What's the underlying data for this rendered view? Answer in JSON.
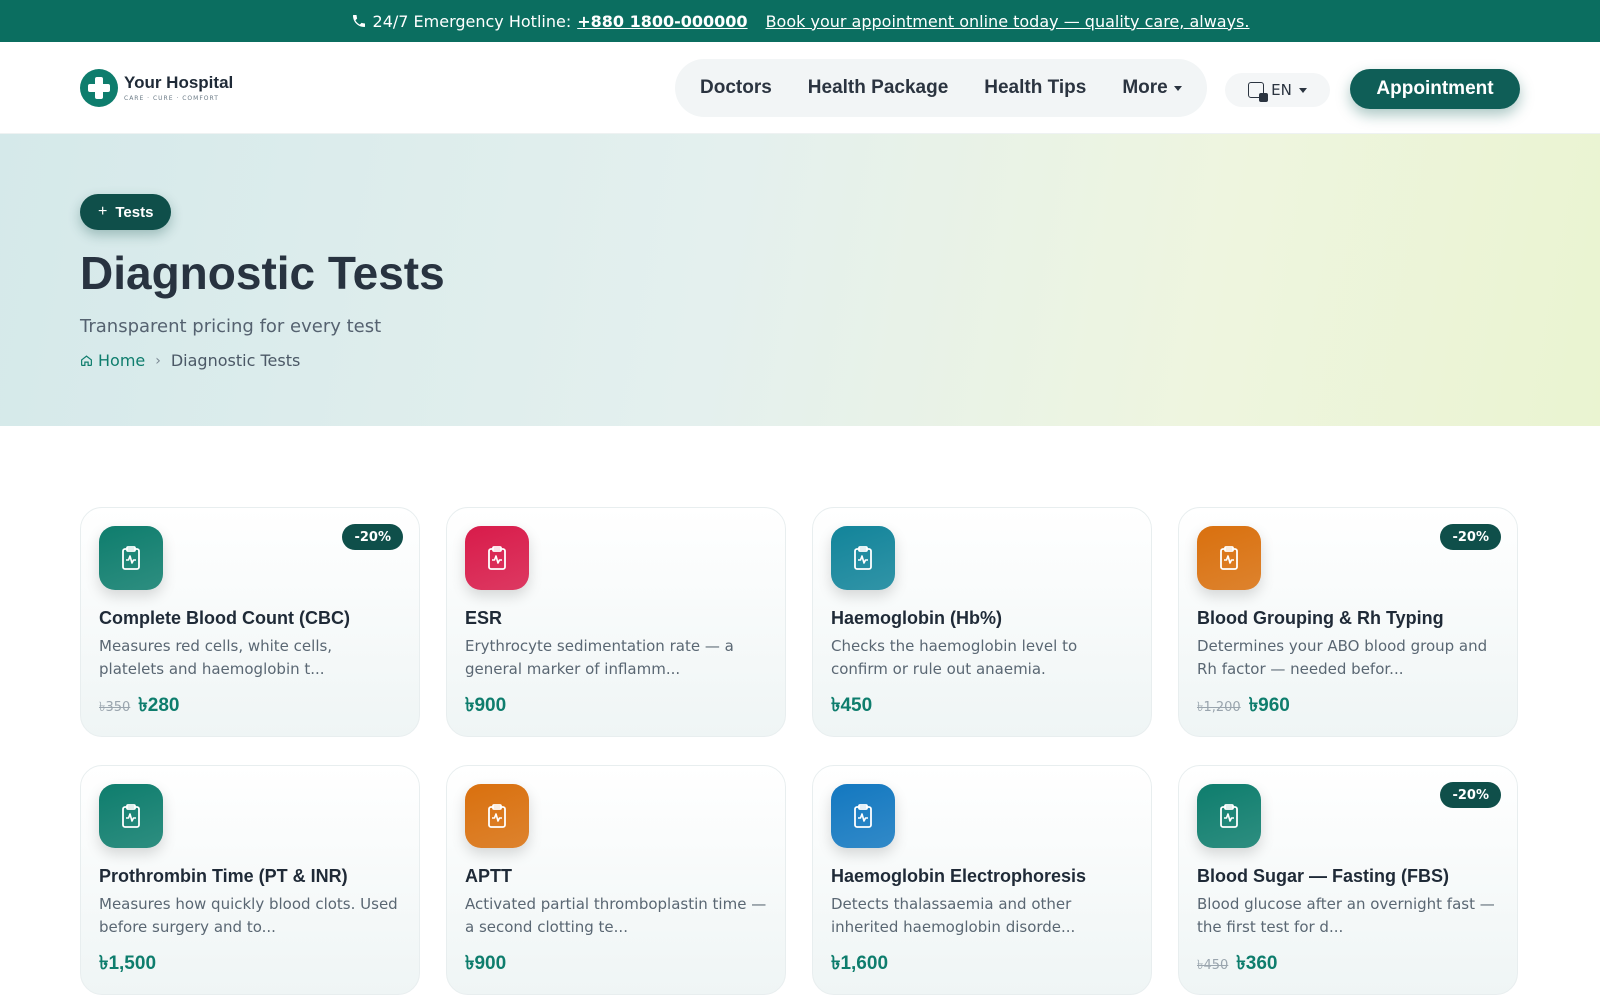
{
  "topbar": {
    "hotline_label": "24/7 Emergency Hotline:",
    "hotline_number": "+880 1800-000000",
    "promo_link": "Book your appointment online today — quality care, always."
  },
  "header": {
    "logo_name": "Your Hospital",
    "logo_tagline": "CARE · CURE · COMFORT",
    "nav": [
      "Doctors",
      "Health Package",
      "Health Tips",
      "More"
    ],
    "language": "EN",
    "appointment_label": "Appointment"
  },
  "hero": {
    "badge": "Tests",
    "title": "Diagnostic Tests",
    "subtitle": "Transparent pricing for every test",
    "breadcrumb_home": "Home",
    "breadcrumb_current": "Diagnostic Tests"
  },
  "tests": [
    {
      "title": "Complete Blood Count (CBC)",
      "desc": "Measures red cells, white cells, platelets and haemoglobin t...",
      "old_price": "৳350",
      "price": "৳280",
      "badge": "-20%",
      "color": "#0e7d6d"
    },
    {
      "title": "ESR",
      "desc": "Erythrocyte sedimentation rate — a general marker of inflamm...",
      "old_price": "",
      "price": "৳900",
      "badge": "",
      "color": "#d81b4a"
    },
    {
      "title": "Haemoglobin (Hb%)",
      "desc": "Checks the haemoglobin level to confirm or rule out anaemia.",
      "old_price": "",
      "price": "৳450",
      "badge": "",
      "color": "#12849a"
    },
    {
      "title": "Blood Grouping & Rh Typing",
      "desc": "Determines your ABO blood group and Rh factor — needed befor...",
      "old_price": "৳1,200",
      "price": "৳960",
      "badge": "-20%",
      "color": "#d9700e"
    },
    {
      "title": "Prothrombin Time (PT & INR)",
      "desc": "Measures how quickly blood clots. Used before surgery and to...",
      "old_price": "",
      "price": "৳1,500",
      "badge": "",
      "color": "#0e7d6d"
    },
    {
      "title": "APTT",
      "desc": "Activated partial thromboplastin time — a second clotting te...",
      "old_price": "",
      "price": "৳900",
      "badge": "",
      "color": "#d9700e"
    },
    {
      "title": "Haemoglobin Electrophoresis",
      "desc": "Detects thalassaemia and other inherited haemoglobin disorde...",
      "old_price": "",
      "price": "৳1,600",
      "badge": "",
      "color": "#1378c0"
    },
    {
      "title": "Blood Sugar — Fasting (FBS)",
      "desc": "Blood glucose after an overnight fast — the first test for d...",
      "old_price": "৳450",
      "price": "৳360",
      "badge": "-20%",
      "color": "#0e7d6d"
    }
  ]
}
